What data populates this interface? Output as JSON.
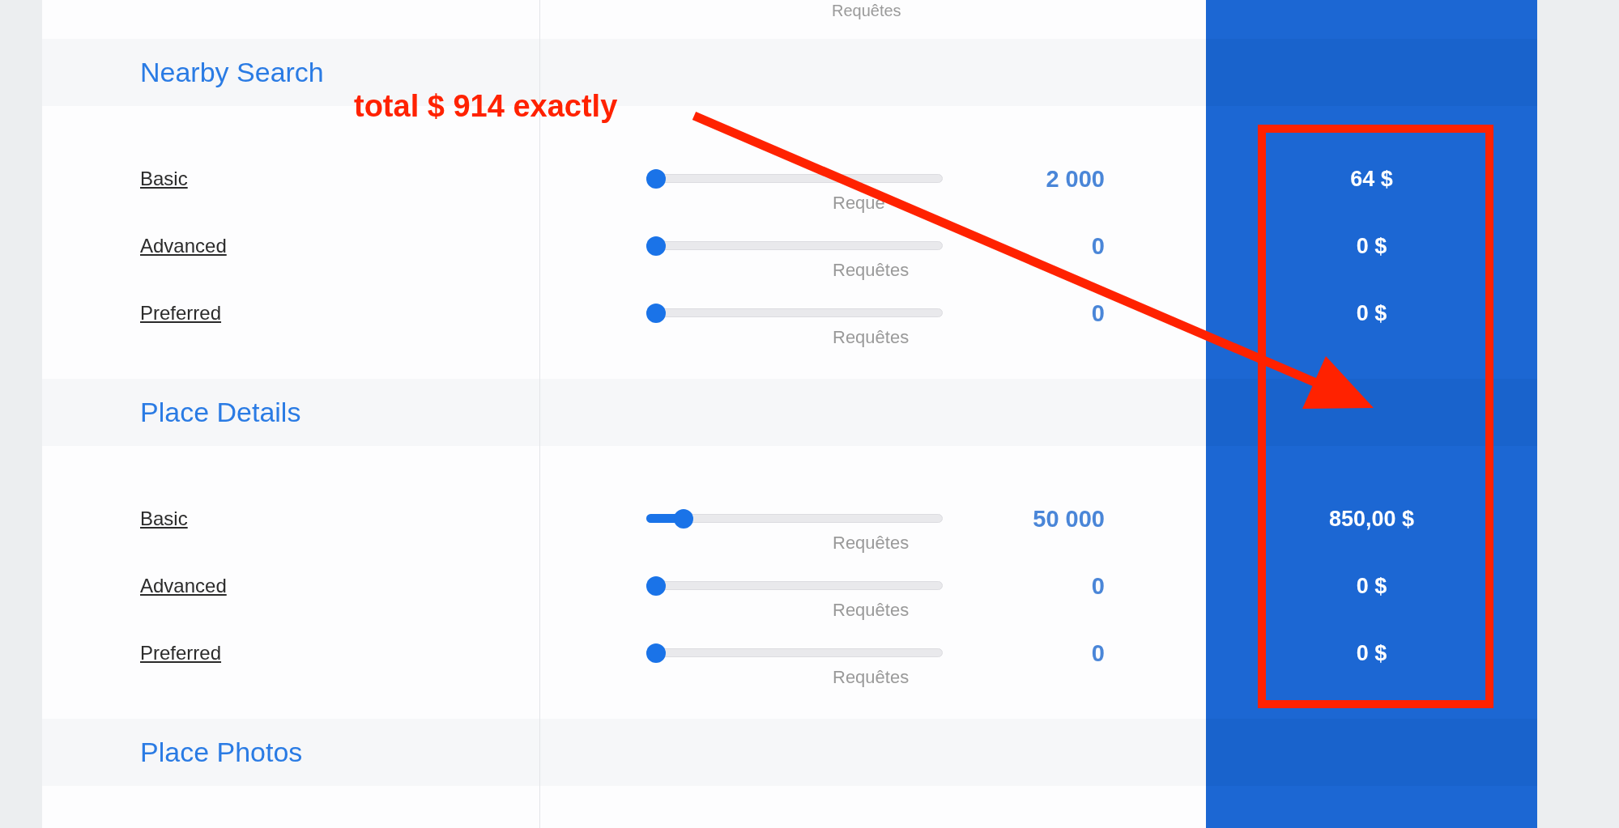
{
  "top_caption": "Requêtes",
  "sections": [
    {
      "title": "Nearby Search",
      "rows": [
        {
          "label": "Basic",
          "level": 0,
          "value": "2 000",
          "caption": "Reque",
          "price": "64 $"
        },
        {
          "label": "Advanced",
          "level": 0,
          "value": "0",
          "caption": "Requêtes",
          "price": "0 $"
        },
        {
          "label": "Preferred",
          "level": 0,
          "value": "0",
          "caption": "Requêtes",
          "price": "0 $"
        }
      ]
    },
    {
      "title": "Place Details",
      "rows": [
        {
          "label": "Basic",
          "level": 0.1,
          "value": "50 000",
          "caption": "Requêtes",
          "price": "850,00 $"
        },
        {
          "label": "Advanced",
          "level": 0,
          "value": "0",
          "caption": "Requêtes",
          "price": "0 $"
        },
        {
          "label": "Preferred",
          "level": 0,
          "value": "0",
          "caption": "Requêtes",
          "price": "0 $"
        }
      ]
    },
    {
      "title": "Place Photos"
    }
  ],
  "annotation": {
    "text": "total $ 914 exactly"
  }
}
